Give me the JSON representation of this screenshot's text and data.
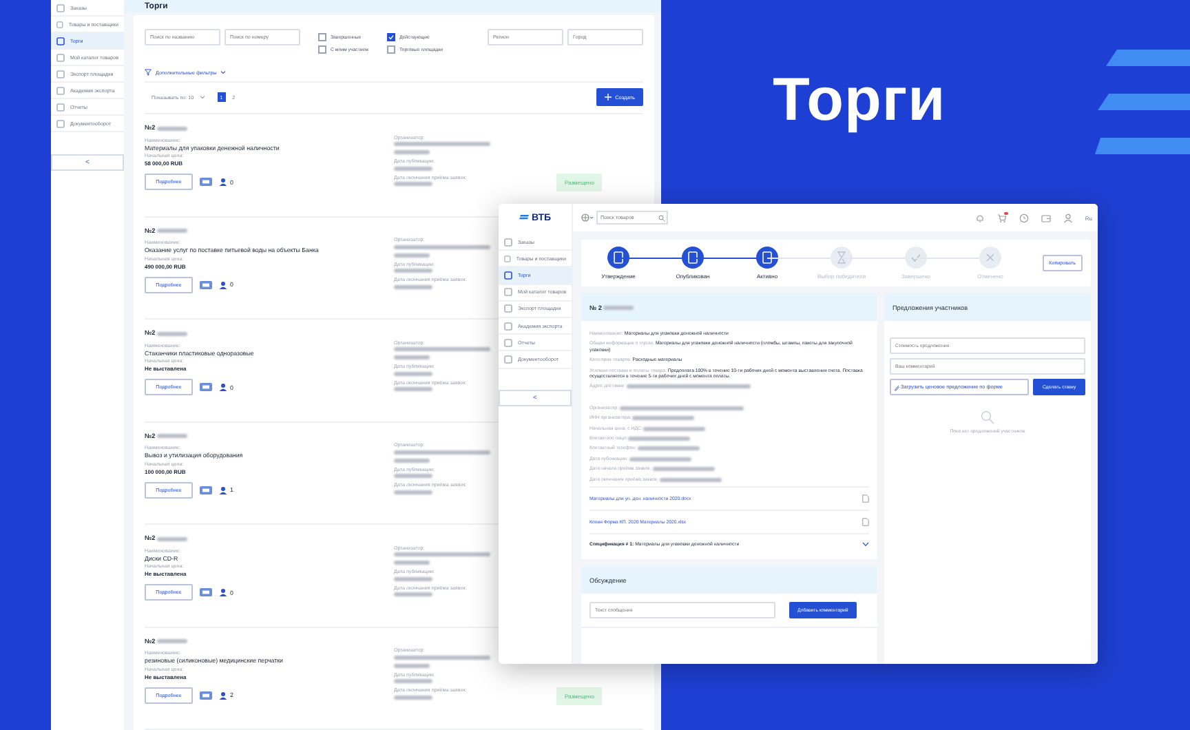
{
  "headline": "Торги",
  "list_screen": {
    "sidebar": {
      "items": [
        {
          "label": "Заказы",
          "selected": false
        },
        {
          "label": "Товары и поставщики",
          "selected": false
        },
        {
          "label": "Торги",
          "selected": true
        },
        {
          "label": "Мой каталог товаров",
          "selected": false
        },
        {
          "label": "Экспорт площадки",
          "selected": false
        },
        {
          "label": "Академия экспорта",
          "selected": false
        },
        {
          "label": "Отчеты",
          "selected": false
        },
        {
          "label": "Документооборот",
          "selected": false
        }
      ],
      "collapse": "<"
    },
    "title": "Торги",
    "filters": {
      "search_fields": [
        {
          "placeholder": "Поиск по названию"
        },
        {
          "placeholder": "Поиск по номеру"
        }
      ],
      "checkboxes": [
        {
          "label": "Завершенные",
          "checked": false
        },
        {
          "label": "Действующие",
          "checked": true
        },
        {
          "label": "С моим участием",
          "checked": false
        },
        {
          "label": "Торговые площадки",
          "checked": false
        }
      ],
      "location_fields": [
        {
          "placeholder": "Регион"
        },
        {
          "placeholder": "Город"
        }
      ],
      "more_filters": "Дополнительные фильтры"
    },
    "pagination": {
      "page_size": "Показывать по: 10",
      "pages": [
        {
          "label": "1",
          "selected": true
        },
        {
          "label": "2",
          "selected": false
        }
      ]
    },
    "create_button": "Создать",
    "lots": [
      {
        "number": "№2",
        "name_label": "Наименование:",
        "name": "Материалы для упаковки денежной наличности",
        "price_label": "Начальная цена:",
        "price": "58 000,00 RUB",
        "organizer_label": "Организатор:",
        "published_label": "Дата публикации:",
        "deadline_label": "Дата окончания приёма заявок:",
        "details_button": "Подробнее",
        "participants": "0",
        "status": "Размещено"
      },
      {
        "number": "№2",
        "name_label": "Наименование:",
        "name": "Оказание услуг по поставке питьевой воды на объекты Банка",
        "price_label": "Начальная цена:",
        "price": "490 000,00 RUB",
        "organizer_label": "Организатор:",
        "published_label": "Дата публикации:",
        "deadline_label": "Дата окончания приёма заявок:",
        "details_button": "Подробнее",
        "participants": "0"
      },
      {
        "number": "№2",
        "name_label": "Наименование:",
        "name": "Стаканчики пластиковые одноразовые",
        "price_label": "Начальная цена:",
        "price": "Не выставлена",
        "organizer_label": "Организатор:",
        "published_label": "Дата публикации:",
        "deadline_label": "Дата окончания приёма заявок:",
        "details_button": "Подробнее",
        "participants": "0"
      },
      {
        "number": "№2",
        "name_label": "Наименование:",
        "name": "Вывоз и утилизация оборудования",
        "price_label": "Начальная цена:",
        "price": "100 000,00 RUB",
        "organizer_label": "Организатор:",
        "published_label": "Дата публикации:",
        "deadline_label": "Дата окончания приёма заявок:",
        "details_button": "Подробнее",
        "participants": "1"
      },
      {
        "number": "№2",
        "name_label": "Наименование:",
        "name": "Диски CD-R",
        "price_label": "Начальная цена:",
        "price": "Не выставлена",
        "organizer_label": "Организатор:",
        "published_label": "Дата публикации:",
        "deadline_label": "Дата окончания приёма заявок:",
        "details_button": "Подробнее",
        "participants": "0"
      },
      {
        "number": "№2",
        "name_label": "Наименование:",
        "name": "резиновые (силиконовые) медицинские перчатки",
        "price_label": "Начальная цена:",
        "price": "Не выставлена",
        "organizer_label": "Организатор:",
        "published_label": "Дата публикации:",
        "deadline_label": "Дата окончания приёма заявок:",
        "details_button": "Подробнее",
        "participants": "2",
        "status": "Размещено"
      }
    ]
  },
  "detail_screen": {
    "logo": "ВТБ",
    "sidebar": {
      "items": [
        {
          "label": "Заказы",
          "selected": false
        },
        {
          "label": "Товары и поставщики",
          "selected": false
        },
        {
          "label": "Торги",
          "selected": true
        },
        {
          "label": "Мой каталог товаров",
          "selected": false
        },
        {
          "label": "Экспорт площадки",
          "selected": false
        },
        {
          "label": "Академия экспорта",
          "selected": false
        },
        {
          "label": "Отчеты",
          "selected": false
        },
        {
          "label": "Документооборот",
          "selected": false
        }
      ],
      "collapse": "<"
    },
    "search": {
      "placeholder": "Поиск товаров"
    },
    "language": "Ru",
    "cart_badge": true,
    "steps": [
      {
        "label": "Утверждение",
        "kind": "document",
        "done": true
      },
      {
        "label": "Опубликован",
        "kind": "document",
        "done": true
      },
      {
        "label": "Активно",
        "kind": "document",
        "done": true
      },
      {
        "label": "Выбор победителя",
        "kind": "hourglass",
        "done": false
      },
      {
        "label": "Завершено",
        "kind": "check",
        "done": false
      },
      {
        "label": "Отменено",
        "kind": "cross",
        "done": false
      }
    ],
    "copy_button": "Копировать",
    "number": "№ 2",
    "fields": [
      {
        "label": "Наименование:",
        "value": "Материалы для упаковки денежной наличности"
      },
      {
        "label": "Общая информация о торгах:",
        "value": "Материалы для упаковки денежной наличности (пломбы, штампы, пакеты для закупочной упаковки)"
      },
      {
        "label": "Категория товаров:",
        "value": "Расходные материалы"
      },
      {
        "label": "Условия поставки и оплаты товара:",
        "value": "Предоплата 100% в течение 10-ти рабочих дней с момента выставления счета. Поставка осуществляется в течение 5-ти рабочих дней с момента оплаты."
      },
      {
        "label": "Адрес доставки:"
      },
      {
        "label": "Организатор:"
      },
      {
        "label": "ИНН организатора:"
      },
      {
        "label": "Начальная цена, с НДС:"
      },
      {
        "label": "Контактное лицо:"
      },
      {
        "label": "Контактный телефон:"
      },
      {
        "label": "Дата публикации:"
      },
      {
        "label": "Дата начала приёма заявок:"
      },
      {
        "label": "Дата окончания приёма заявок:"
      }
    ],
    "files": [
      {
        "name": "Материалы для уп. ден. наличности 2020.docx"
      },
      {
        "name": "Копия Форма КП. 2020 Материалы 2020.xlsx"
      }
    ],
    "specification": {
      "label": "Спецификация # 1:",
      "value": "Материалы для упаковки денежной наличности",
      "expanded": false
    },
    "discussion": {
      "title": "Обсуждение",
      "placeholder": "Текст сообщения",
      "button": "Добавить комментарий"
    },
    "offers": {
      "title": "Предложения участников",
      "price_placeholder": "Стоимость предложения",
      "comment_placeholder": "Ваш комментарий",
      "upload_button": "Загрузить ценовое предложение по форме",
      "bid_button": "Сделать ставку",
      "empty": "Пока нет предложений участников"
    }
  }
}
